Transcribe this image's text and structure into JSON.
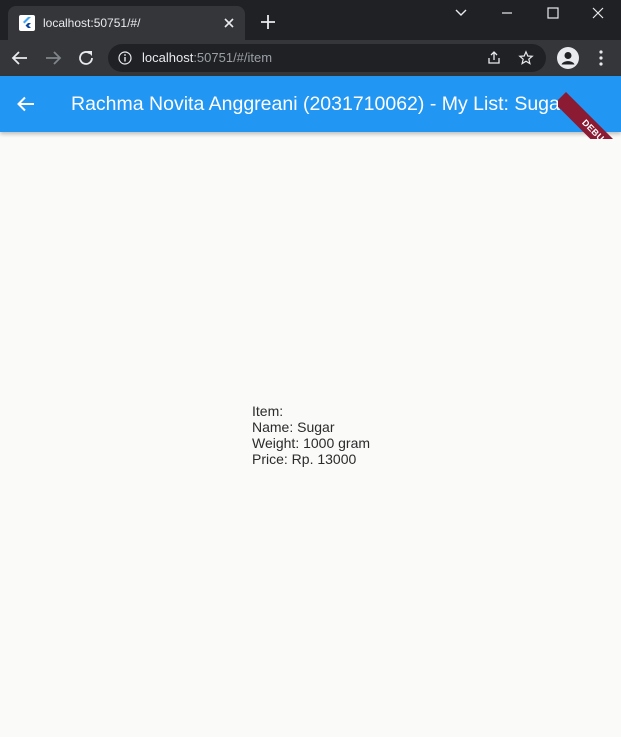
{
  "browser": {
    "tab_title": "localhost:50751/#/",
    "url_host": "localhost",
    "url_rest": ":50751/#/item"
  },
  "appbar": {
    "title": "Rachma Novita Anggreani (2031710062) - My List: Sugar",
    "debug_banner": "DEBUG"
  },
  "item": {
    "heading": "Item:",
    "name": "Name: Sugar",
    "weight": "Weight: 1000 gram",
    "price": "Price: Rp. 13000"
  },
  "colors": {
    "appbar": "#2196f3",
    "debug_ribbon": "#8b1a33",
    "page_background": "#fafaf8"
  }
}
